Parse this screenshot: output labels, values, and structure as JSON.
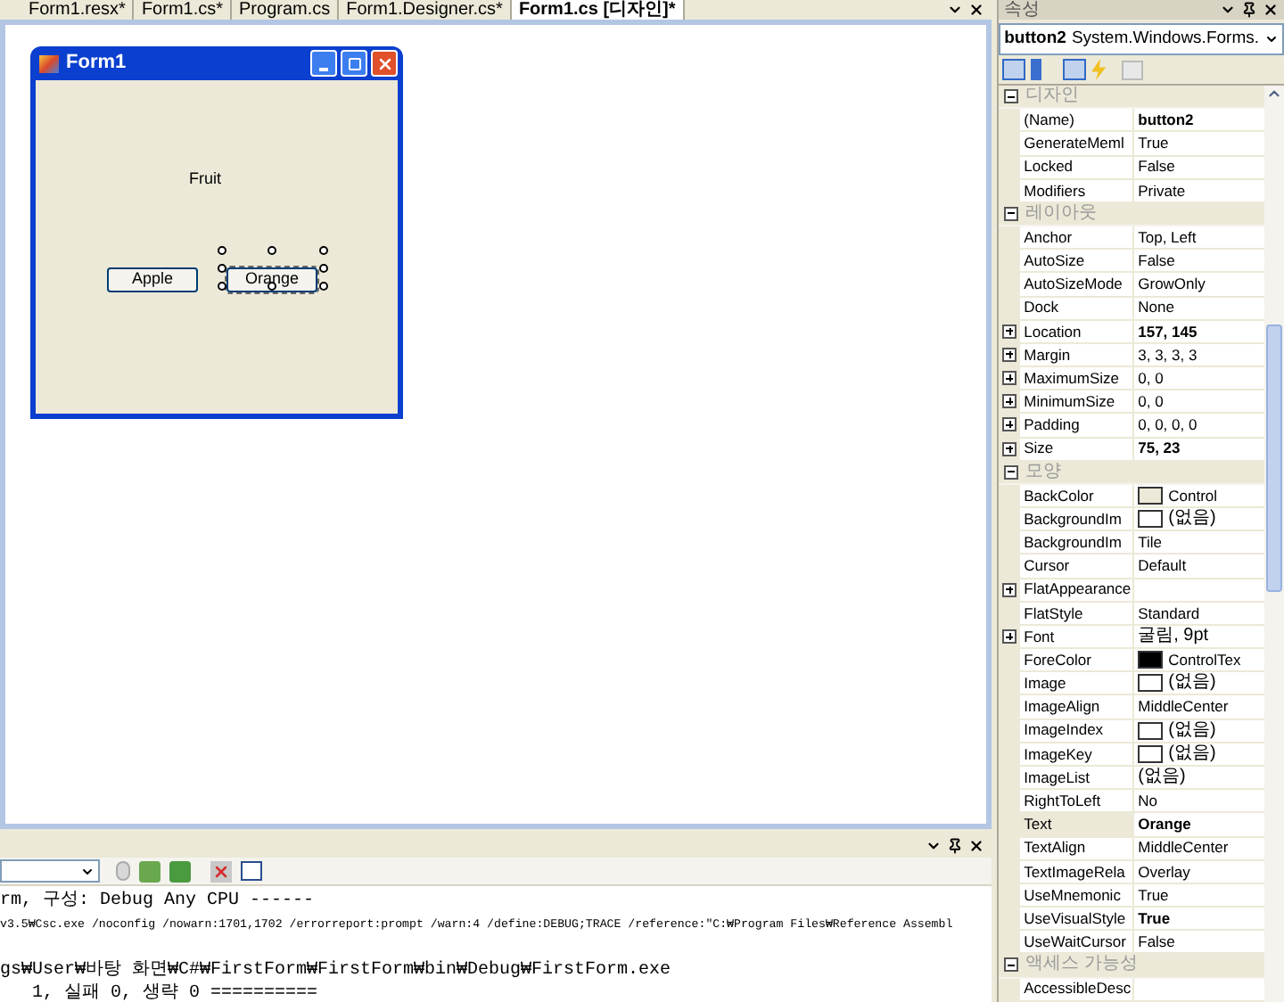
{
  "tabs": [
    {
      "label": "Form1.resx*",
      "selected": false
    },
    {
      "label": "Form1.cs*",
      "selected": false
    },
    {
      "label": "Program.cs",
      "selected": false
    },
    {
      "label": "Form1.Designer.cs*",
      "selected": false
    },
    {
      "label": "Form1.cs [디자인]*",
      "selected": true
    }
  ],
  "form": {
    "title": "Form1",
    "label": "Fruit",
    "buttons": [
      {
        "label": "Apple",
        "selected": false
      },
      {
        "label": "Orange",
        "selected": true
      }
    ]
  },
  "output": {
    "lines": [
      {
        "text": "rm, 구성: Debug Any CPU ------",
        "spaced": false
      },
      {
        "text": "v3.5₩Csc.exe /noconfig /nowarn:1701,1702 /errorreport:prompt /warn:4 /define:DEBUG;TRACE /reference:\"C:₩Program Files₩Reference Assembl",
        "spaced": false
      },
      {
        "text": "gs₩User₩바탕 화면₩C#₩FirstForm₩FirstForm₩bin₩Debug₩FirstForm.exe",
        "spaced": true
      },
      {
        "text": "1, 실패 0, 생략 0 ==========",
        "spaced": false
      }
    ]
  },
  "properties": {
    "title": "속성",
    "object_name": "button2",
    "object_type": "System.Windows.Forms.",
    "rows": [
      {
        "kind": "category",
        "name": "디자인"
      },
      {
        "kind": "property",
        "name": "(Name)",
        "value": "button2",
        "bold": true,
        "expandable": false,
        "selected": false
      },
      {
        "kind": "property",
        "name": "GenerateMeml",
        "value": "True",
        "bold": false,
        "expandable": false,
        "selected": false
      },
      {
        "kind": "property",
        "name": "Locked",
        "value": "False",
        "bold": false,
        "expandable": false,
        "selected": false
      },
      {
        "kind": "property",
        "name": "Modifiers",
        "value": "Private",
        "bold": false,
        "expandable": false,
        "selected": false
      },
      {
        "kind": "category",
        "name": "레이아웃"
      },
      {
        "kind": "property",
        "name": "Anchor",
        "value": "Top, Left",
        "bold": false,
        "expandable": false,
        "selected": false
      },
      {
        "kind": "property",
        "name": "AutoSize",
        "value": "False",
        "bold": false,
        "expandable": false,
        "selected": false
      },
      {
        "kind": "property",
        "name": "AutoSizeMode",
        "value": "GrowOnly",
        "bold": false,
        "expandable": false,
        "selected": false
      },
      {
        "kind": "property",
        "name": "Dock",
        "value": "None",
        "bold": false,
        "expandable": false,
        "selected": false
      },
      {
        "kind": "property",
        "name": "Location",
        "value": "157, 145",
        "bold": true,
        "expandable": true,
        "selected": false
      },
      {
        "kind": "property",
        "name": "Margin",
        "value": "3, 3, 3, 3",
        "bold": false,
        "expandable": true,
        "selected": false
      },
      {
        "kind": "property",
        "name": "MaximumSize",
        "value": "0, 0",
        "bold": false,
        "expandable": true,
        "selected": false
      },
      {
        "kind": "property",
        "name": "MinimumSize",
        "value": "0, 0",
        "bold": false,
        "expandable": true,
        "selected": false
      },
      {
        "kind": "property",
        "name": "Padding",
        "value": "0, 0, 0, 0",
        "bold": false,
        "expandable": true,
        "selected": false
      },
      {
        "kind": "property",
        "name": "Size",
        "value": "75, 23",
        "bold": true,
        "expandable": true,
        "selected": false
      },
      {
        "kind": "category",
        "name": "모양"
      },
      {
        "kind": "property",
        "name": "BackColor",
        "value": "Control",
        "bold": false,
        "expandable": false,
        "selected": false,
        "color": "#ece9d8"
      },
      {
        "kind": "property",
        "name": "BackgroundIm",
        "value": "(없음)",
        "bold": false,
        "expandable": false,
        "selected": false,
        "color": "#ffffff"
      },
      {
        "kind": "property",
        "name": "BackgroundIm",
        "value": "Tile",
        "bold": false,
        "expandable": false,
        "selected": false
      },
      {
        "kind": "property",
        "name": "Cursor",
        "value": "Default",
        "bold": false,
        "expandable": false,
        "selected": false
      },
      {
        "kind": "property",
        "name": "FlatAppearance",
        "expandable": true,
        "selected": false
      },
      {
        "kind": "property",
        "name": "FlatStyle",
        "value": "Standard",
        "bold": false,
        "expandable": false,
        "selected": false
      },
      {
        "kind": "property",
        "name": "Font",
        "value": "굴림, 9pt",
        "bold": false,
        "expandable": true,
        "selected": false
      },
      {
        "kind": "property",
        "name": "ForeColor",
        "value": "ControlTex",
        "bold": false,
        "expandable": false,
        "selected": false,
        "color": "#000000"
      },
      {
        "kind": "property",
        "name": "Image",
        "value": "(없음)",
        "bold": false,
        "expandable": false,
        "selected": false,
        "color": "#ffffff"
      },
      {
        "kind": "property",
        "name": "ImageAlign",
        "value": "MiddleCenter",
        "bold": false,
        "expandable": false,
        "selected": false
      },
      {
        "kind": "property",
        "name": "ImageIndex",
        "value": "(없음)",
        "bold": false,
        "expandable": false,
        "selected": false,
        "color": "#ffffff"
      },
      {
        "kind": "property",
        "name": "ImageKey",
        "value": "(없음)",
        "bold": false,
        "expandable": false,
        "selected": false,
        "color": "#ffffff"
      },
      {
        "kind": "property",
        "name": "ImageList",
        "value": "(없음)",
        "bold": false,
        "expandable": false,
        "selected": false
      },
      {
        "kind": "property",
        "name": "RightToLeft",
        "value": "No",
        "bold": false,
        "expandable": false,
        "selected": false
      },
      {
        "kind": "property",
        "name": "Text",
        "value": "Orange",
        "bold": true,
        "expandable": false,
        "selected": true
      },
      {
        "kind": "property",
        "name": "TextAlign",
        "value": "MiddleCenter",
        "bold": false,
        "expandable": false,
        "selected": false
      },
      {
        "kind": "property",
        "name": "TextImageRela",
        "value": "Overlay",
        "bold": false,
        "expandable": false,
        "selected": false
      },
      {
        "kind": "property",
        "name": "UseMnemonic",
        "value": "True",
        "bold": false,
        "expandable": false,
        "selected": false
      },
      {
        "kind": "property",
        "name": "UseVisualStyle",
        "value": "True",
        "bold": true,
        "expandable": false,
        "selected": false
      },
      {
        "kind": "property",
        "name": "UseWaitCursor",
        "value": "False",
        "bold": false,
        "expandable": false,
        "selected": false
      },
      {
        "kind": "category",
        "name": "액세스 가능성"
      },
      {
        "kind": "property",
        "name": "AccessibleDesc",
        "expandable": false,
        "selected": false
      }
    ]
  }
}
